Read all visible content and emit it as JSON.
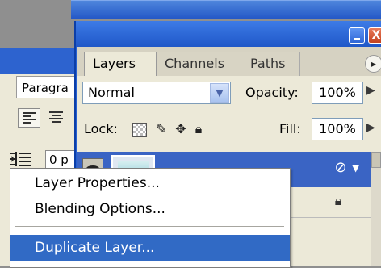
{
  "paragraph_panel": {
    "tab_label": "Paragra",
    "indent_value": "0 p"
  },
  "layers_panel": {
    "tabs": [
      {
        "label": "Layers",
        "active": true
      },
      {
        "label": "Channels",
        "active": false
      },
      {
        "label": "Paths",
        "active": false
      }
    ],
    "blend_mode": "Normal",
    "opacity_label": "Opacity:",
    "opacity_value": "100%",
    "lock_label": "Lock:",
    "fill_label": "Fill:",
    "fill_value": "100%",
    "window_close_glyph": "X"
  },
  "context_menu": {
    "items": [
      {
        "label": "Layer Properties...",
        "highlighted": false
      },
      {
        "label": "Blending Options...",
        "highlighted": false
      },
      {
        "label": "Duplicate Layer...",
        "highlighted": true
      }
    ]
  },
  "colors": {
    "title_blue": "#2560d2",
    "selection_blue": "#316ac5",
    "panel_bg": "#ece9d8"
  }
}
